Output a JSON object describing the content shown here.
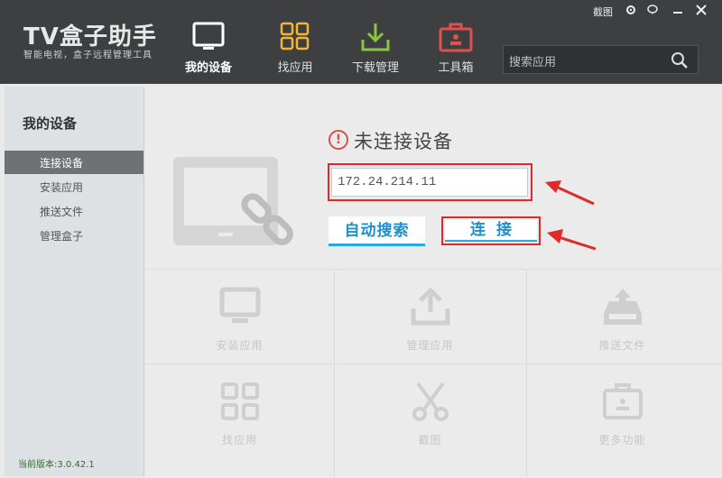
{
  "app": {
    "logo": "TV盒子助手",
    "tagline": "智能电视，盒子远程管理工具"
  },
  "window": {
    "screenshot_label": "截图"
  },
  "nav": {
    "items": [
      {
        "label": "我的设备",
        "icon": "monitor-icon",
        "active": true
      },
      {
        "label": "找应用",
        "icon": "grid-icon"
      },
      {
        "label": "下载管理",
        "icon": "download-icon"
      },
      {
        "label": "工具箱",
        "icon": "toolbox-icon"
      }
    ]
  },
  "search": {
    "placeholder": "搜索应用"
  },
  "sidebar": {
    "title": "我的设备",
    "items": [
      {
        "label": "连接设备",
        "active": true
      },
      {
        "label": "安装应用"
      },
      {
        "label": "推送文件"
      },
      {
        "label": "管理盒子"
      }
    ],
    "version": "当前版本:3.0.42.1"
  },
  "main": {
    "status": "未连接设备",
    "ip_value": "172.24.214.11",
    "auto_search_label": "自动搜索",
    "connect_label": "连接",
    "tiles": [
      {
        "label": "安装应用",
        "icon": "install-icon"
      },
      {
        "label": "管理应用",
        "icon": "upload-icon"
      },
      {
        "label": "推送文件",
        "icon": "inbox-icon"
      },
      {
        "label": "找应用",
        "icon": "grid-icon"
      },
      {
        "label": "截图",
        "icon": "scissors-icon"
      },
      {
        "label": "更多功能",
        "icon": "briefcase-icon"
      }
    ]
  },
  "colors": {
    "topbar": "#3d3f40",
    "accent": "#27a9e1",
    "highlight": "#e02a2a",
    "download_green": "#8cc63f",
    "toolbox_red": "#e05050",
    "grid_yellow": "#f2b632"
  }
}
